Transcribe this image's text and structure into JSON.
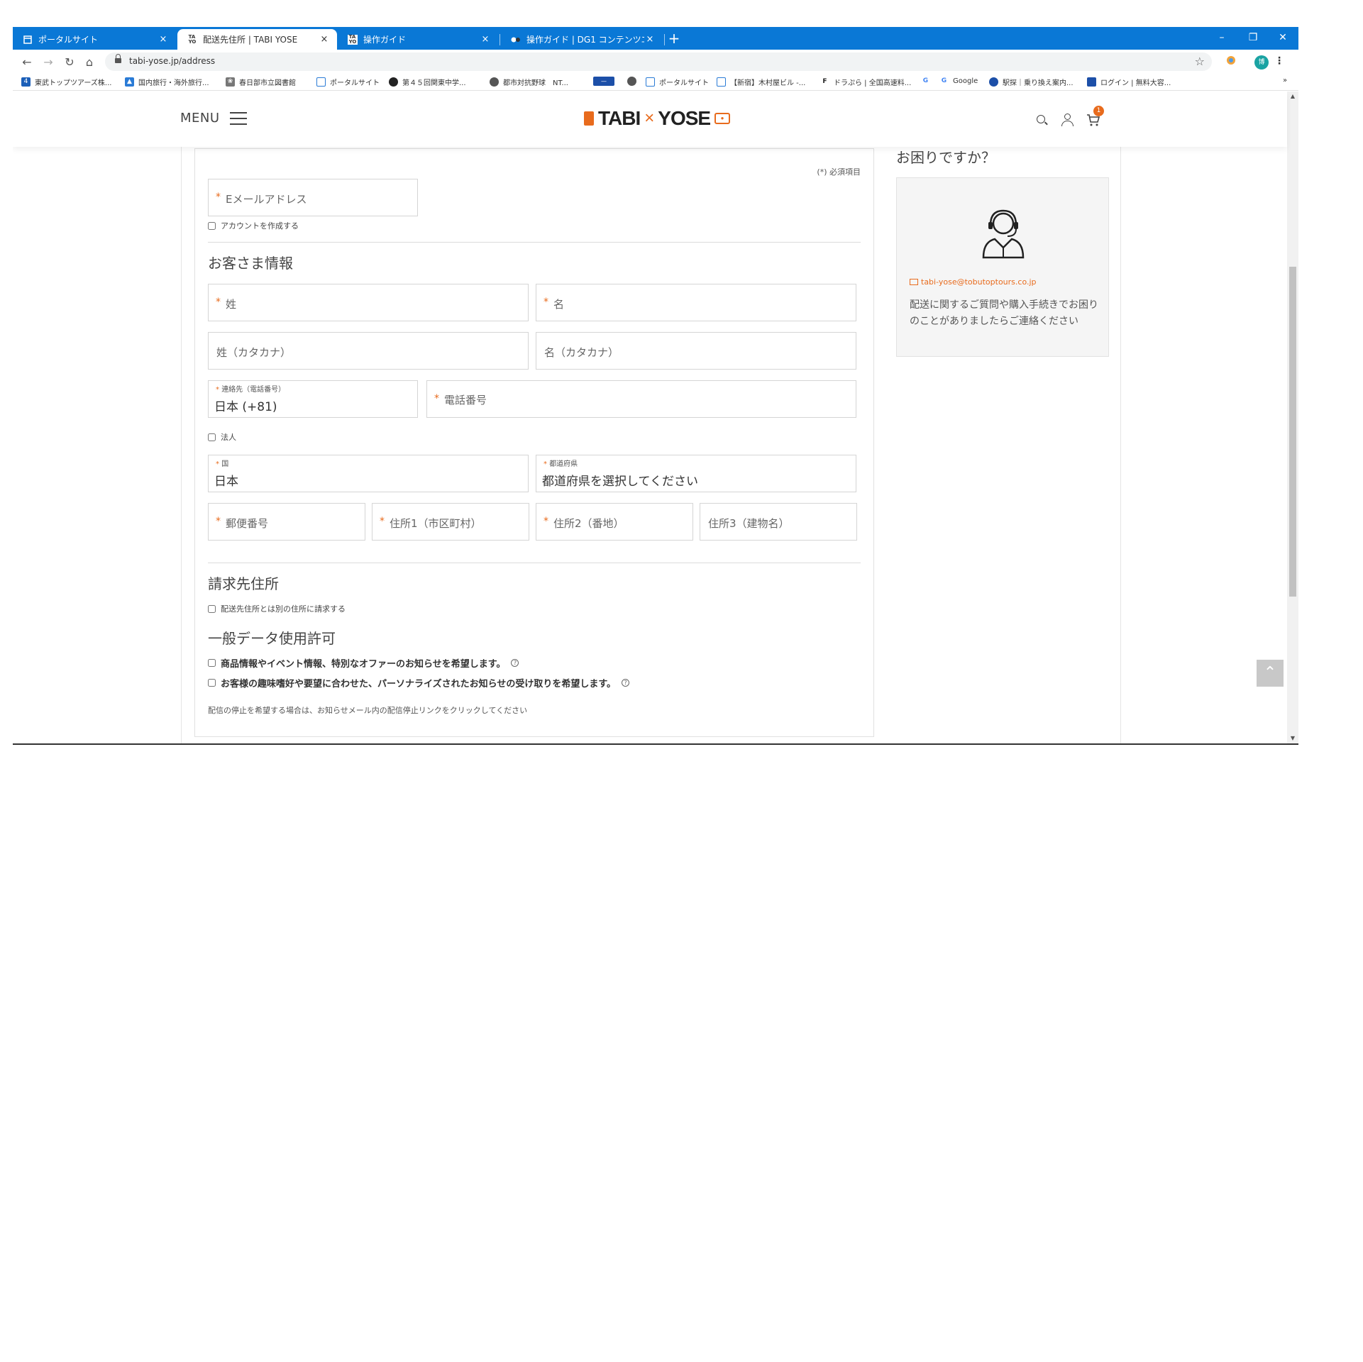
{
  "browser": {
    "tabs": [
      {
        "title": "ポータルサイト",
        "favicon": "portal-icon",
        "active": false
      },
      {
        "title": "配送先住所 | TABI YOSE",
        "favicon": "tabi-yose-icon",
        "active": true
      },
      {
        "title": "操作ガイド",
        "favicon": "tabi-yose-icon",
        "active": false
      },
      {
        "title": "操作ガイド | DG1 コンテンツエディター",
        "favicon": "dg1-icon",
        "active": false
      }
    ],
    "new_tab": "+",
    "close_glyph": "×",
    "url": "tabi-yose.jp/address",
    "profile_initial": "博",
    "bookmarks": [
      "東武トップツアーズ株...",
      "国内旅行・海外旅行...",
      "春日部市立図書館",
      "ポータルサイト",
      "第４５回関東中学...",
      "都市対抗野球　NT...",
      "",
      "",
      "ポータルサイト",
      "【新宿】木村屋ビル -...",
      "ドラぷら | 全国高速料...",
      "",
      "Google",
      "駅探｜乗り換え案内...",
      "ログイン | 無料大容..."
    ],
    "bookmarks_overflow": "»"
  },
  "site": {
    "menu_label": "MENU",
    "logo_left": "TABI",
    "logo_x": "×",
    "logo_right": "YOSE",
    "cart_count": "1",
    "accent_color": "#e86b1d"
  },
  "form": {
    "required_note": "(*) 必須項目",
    "email_placeholder": "Eメールアドレス",
    "create_account_label": "アカウントを作成する",
    "customer_info_title": "お客さま情報",
    "last_name": "姓",
    "first_name": "名",
    "last_name_kana": "姓（カタカナ）",
    "first_name_kana": "名（カタカナ）",
    "phone_country_label": "連絡先（電話番号）",
    "phone_country_value": "日本 (+81)",
    "phone_number": "電話番号",
    "corporation_label": "法人",
    "country_label": "国",
    "country_value": "日本",
    "prefecture_label": "都道府県",
    "prefecture_value": "都道府県を選択してください",
    "postal_code": "郵便番号",
    "address1": "住所1（市区町村）",
    "address2": "住所2（番地）",
    "address3": "住所3（建物名）",
    "billing_title": "請求先住所",
    "billing_checkbox": "配送先住所とは別の住所に請求する",
    "consent_title": "一般データ使用許可",
    "consent1": "商品情報やイベント情報、特別なオファーのお知らせを希望します。",
    "consent2": "お客様の趣味嗜好や要望に合わせた、パーソナライズされたお知らせの受け取りを希望します。",
    "unsubscribe_note": "配信の停止を希望する場合は、お知らせメール内の配信停止リンクをクリックしてください"
  },
  "help": {
    "title": "お困りですか？",
    "email": "tabi-yose@tobutoptours.co.jp",
    "text": "配送に関するご質問や購入手続きでお困りのことがありましたらご連絡ください"
  }
}
